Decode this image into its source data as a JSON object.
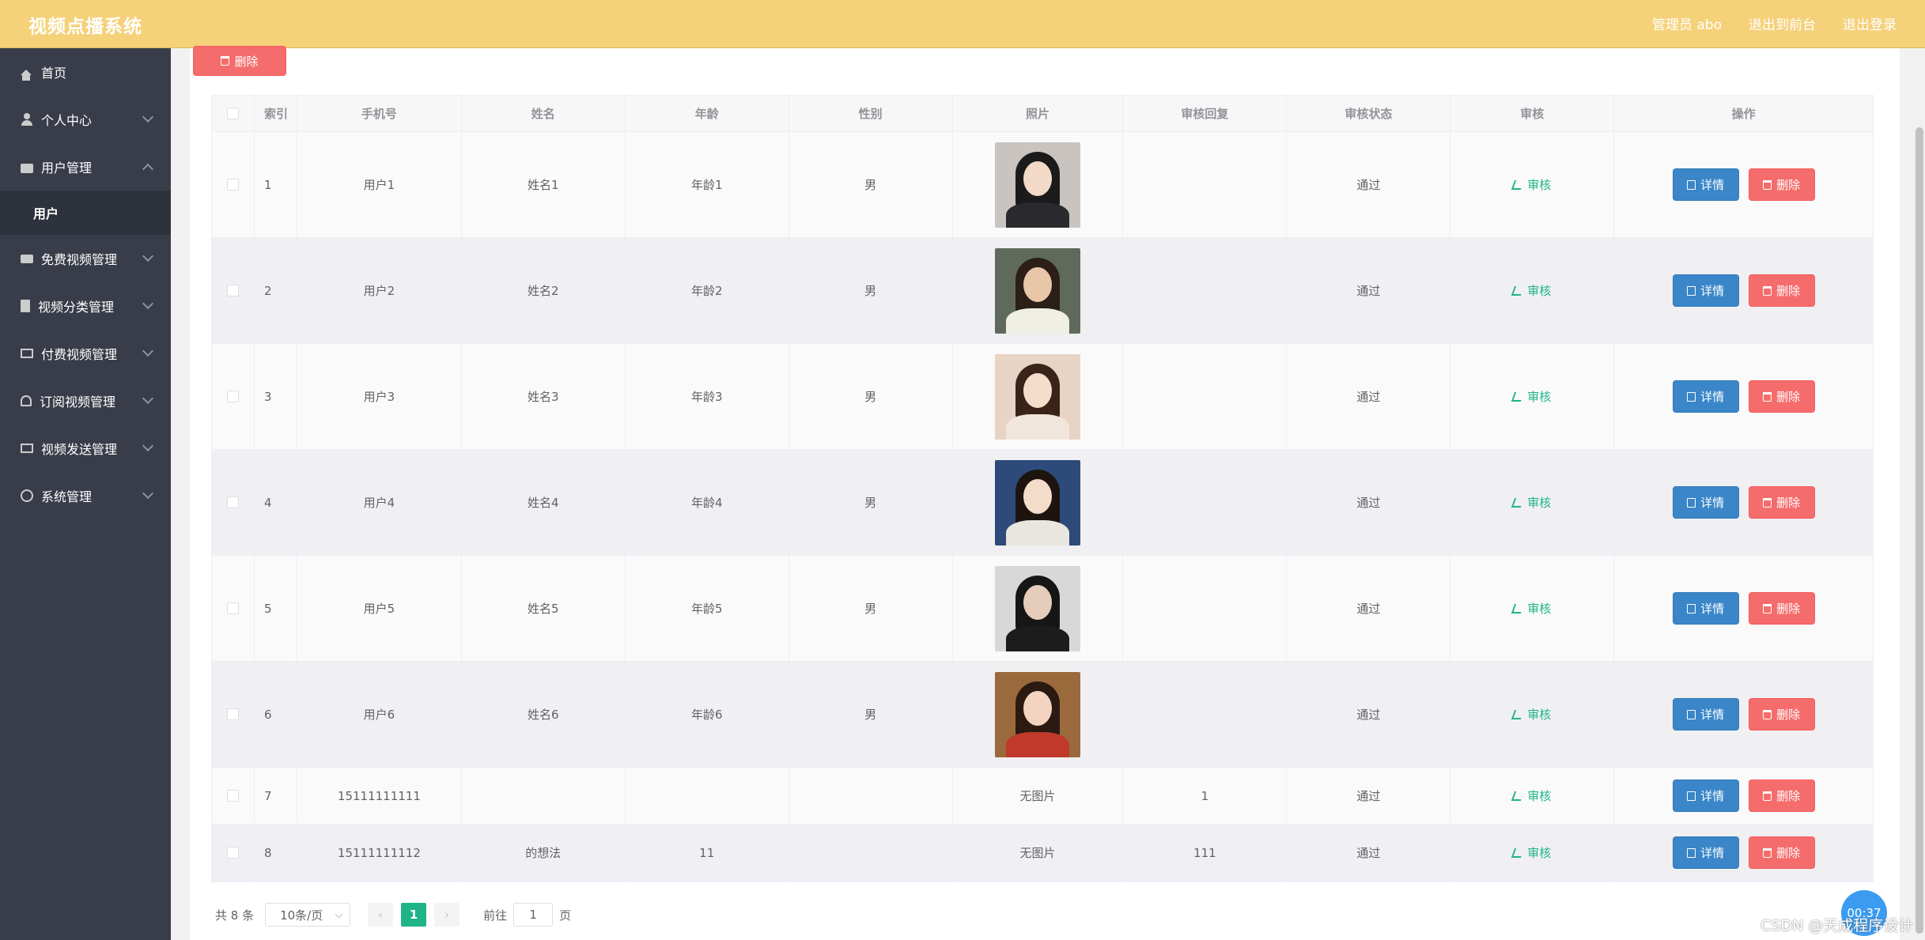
{
  "app": {
    "title": "视频点播系统"
  },
  "topbar": {
    "admin": "管理员 abo",
    "front": "退出到前台",
    "logout": "退出登录"
  },
  "sidebar": {
    "items": [
      {
        "label": "首页"
      },
      {
        "label": "个人中心"
      },
      {
        "label": "用户管理"
      },
      {
        "label": "用户"
      },
      {
        "label": "免费视频管理"
      },
      {
        "label": "视频分类管理"
      },
      {
        "label": "付费视频管理"
      },
      {
        "label": "订阅视频管理"
      },
      {
        "label": "视频发送管理"
      },
      {
        "label": "系统管理"
      }
    ]
  },
  "toolbar": {
    "delete_label": "删除"
  },
  "table": {
    "headers": {
      "index": "索引",
      "phone": "手机号",
      "name": "姓名",
      "age": "年龄",
      "sex": "性别",
      "photo": "照片",
      "reply": "审核回复",
      "status": "审核状态",
      "audit": "审核",
      "ops": "操作"
    },
    "audit_label": "审核",
    "detail_label": "详情",
    "delete_label": "删除",
    "rows": [
      {
        "index": "1",
        "phone": "用户1",
        "name": "姓名1",
        "age": "年龄1",
        "sex": "男",
        "photo": "",
        "reply": "",
        "status": "通过"
      },
      {
        "index": "2",
        "phone": "用户2",
        "name": "姓名2",
        "age": "年龄2",
        "sex": "男",
        "photo": "",
        "reply": "",
        "status": "通过"
      },
      {
        "index": "3",
        "phone": "用户3",
        "name": "姓名3",
        "age": "年龄3",
        "sex": "男",
        "photo": "",
        "reply": "",
        "status": "通过"
      },
      {
        "index": "4",
        "phone": "用户4",
        "name": "姓名4",
        "age": "年龄4",
        "sex": "男",
        "photo": "",
        "reply": "",
        "status": "通过"
      },
      {
        "index": "5",
        "phone": "用户5",
        "name": "姓名5",
        "age": "年龄5",
        "sex": "男",
        "photo": "",
        "reply": "",
        "status": "通过"
      },
      {
        "index": "6",
        "phone": "用户6",
        "name": "姓名6",
        "age": "年龄6",
        "sex": "男",
        "photo": "",
        "reply": "",
        "status": "通过"
      },
      {
        "index": "7",
        "phone": "15111111111",
        "name": "",
        "age": "",
        "sex": "",
        "photo": "无图片",
        "reply": "1",
        "status": "通过"
      },
      {
        "index": "8",
        "phone": "15111111112",
        "name": "的想法",
        "age": "11",
        "sex": "",
        "photo": "无图片",
        "reply": "111",
        "status": "通过"
      }
    ]
  },
  "pagination": {
    "total": "共 8 条",
    "page_size": "10条/页",
    "current": "1",
    "goto_prefix": "前往",
    "goto_value": "1",
    "goto_suffix": "页"
  },
  "overlay": {
    "watermark": "CSDN @天成程序设计",
    "timer": "00:37"
  },
  "colors": {
    "topbar": "#f5d17a",
    "sidebar": "#393d49",
    "accent": "#1fb488",
    "danger": "#f56c6c",
    "primary": "#3a86c8"
  }
}
